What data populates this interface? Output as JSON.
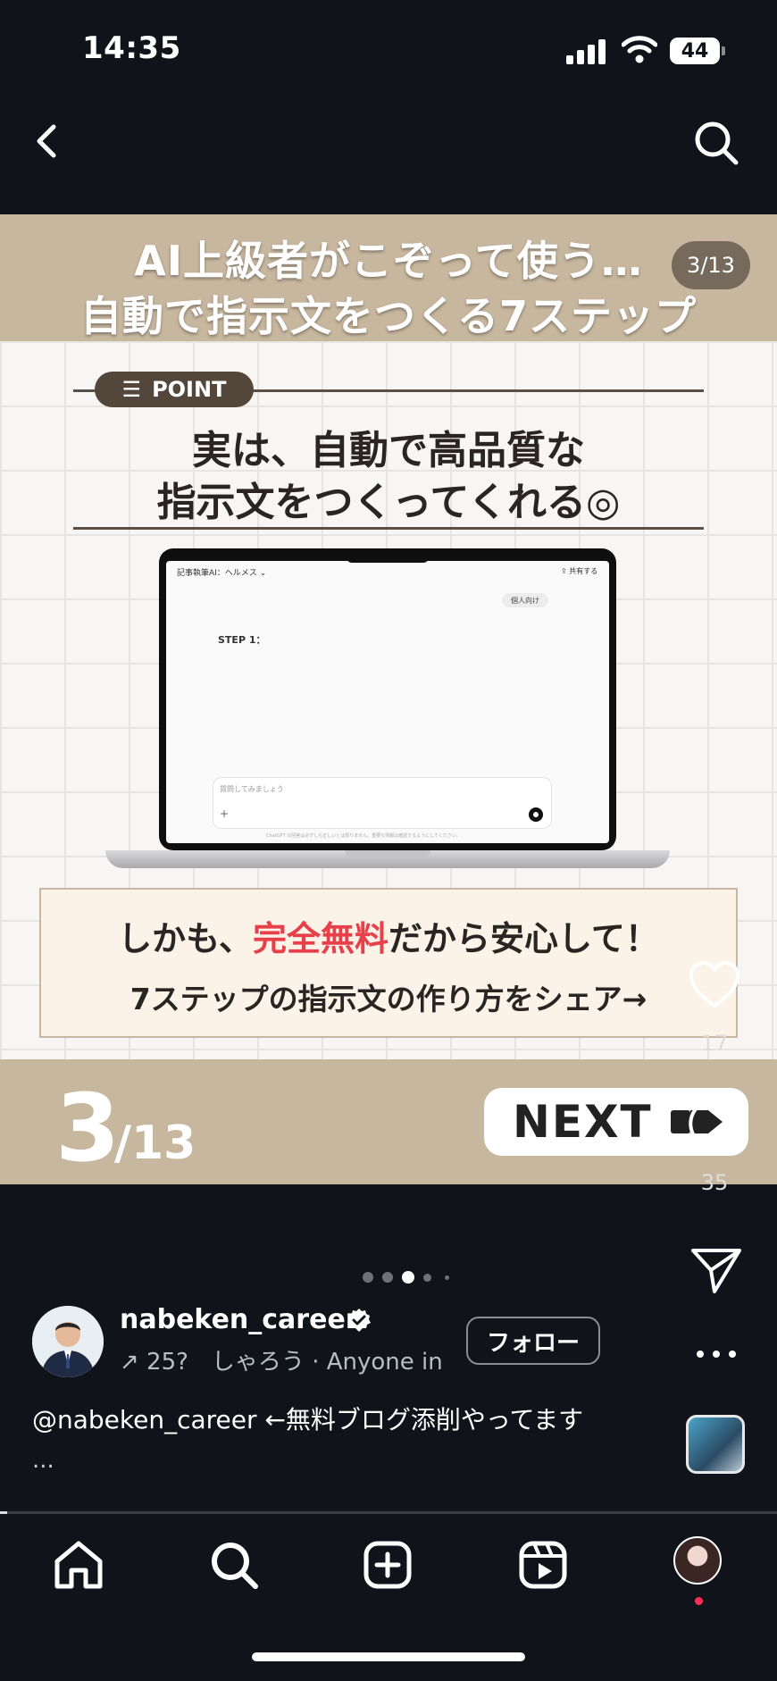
{
  "status_bar": {
    "time": "14:35",
    "battery": "44"
  },
  "nav": {
    "back_icon": "chevron-left-icon",
    "search_icon": "search-icon"
  },
  "slide": {
    "title_line1": "AI上級者がこぞって使う…",
    "title_line2": "自動で指示文をつくる7ステップ",
    "counter": "3/13",
    "point_label": "POINT",
    "heading_line1": "実は、自動で高品質な",
    "heading_line2": "指示文をつくってくれる◎",
    "screen": {
      "title": "記事執筆AI：ヘルメス ⌄",
      "share": "⇪ 共有する",
      "pill": "個人向け",
      "step": "STEP 1：",
      "input_placeholder": "質問してみましょう",
      "footer": "ChatGPT の回答は必ずしも正しいとは限りません。重要な情報は確認するようにしてください。"
    },
    "note_pre": "しかも、",
    "note_accent": "完全無料",
    "note_post": "だから安心して！",
    "note_line2": "7ステップの指示文の作り方をシェア→",
    "page_number": "3",
    "page_total": "/13",
    "next_label": "NEXT"
  },
  "rail": {
    "likes": "17",
    "comments": "35"
  },
  "carousel": {
    "total_dots": 5,
    "active_index": 2
  },
  "post": {
    "username": "nabeken_career",
    "subline": "↗ 25?　しゃろう · Anyone in",
    "follow_label": "フォロー",
    "caption": "@nabeken_career ←無料ブログ添削やってます",
    "caption_more": "..."
  },
  "colors": {
    "brand_beige": "#c8b79f",
    "accent_red": "#e8404a",
    "background": "#10131a"
  }
}
